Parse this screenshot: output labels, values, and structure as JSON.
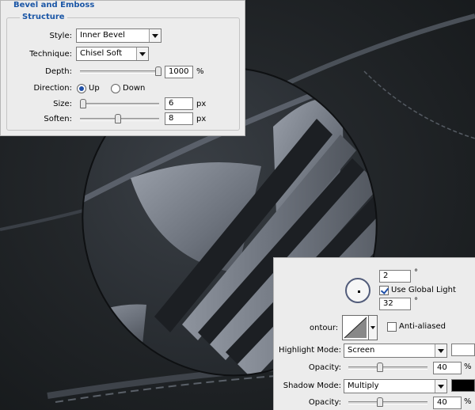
{
  "colors": {
    "accent": "#1a56a6",
    "highlight_swatch": "#ffffff",
    "shadow_swatch": "#000000"
  },
  "bevel_panel": {
    "title": "Bevel and Emboss",
    "section": "Structure",
    "style": {
      "label": "Style:",
      "value": "Inner Bevel"
    },
    "technique": {
      "label": "Technique:",
      "value": "Chisel Soft"
    },
    "depth": {
      "label": "Depth:",
      "value": "1000",
      "unit": "%",
      "slider_fraction": 1.0
    },
    "direction": {
      "label": "Direction:",
      "option_up": "Up",
      "option_down": "Down",
      "selected": "Up"
    },
    "size": {
      "label": "Size:",
      "value": "6",
      "unit": "px",
      "slider_fraction": 0.0
    },
    "soften": {
      "label": "Soften:",
      "value": "8",
      "unit": "px",
      "slider_fraction": 0.5
    }
  },
  "shading_panel": {
    "angle": {
      "value": "2",
      "unit": "°"
    },
    "use_global_light": {
      "label": "Use Global Light",
      "checked": true
    },
    "altitude": {
      "value": "32",
      "unit": "°"
    },
    "gloss_contour": {
      "label": "ontour:",
      "icon": "contour-linear-icon"
    },
    "anti_aliased": {
      "label": "Anti-aliased",
      "checked": false
    },
    "highlight_mode": {
      "label": "Highlight Mode:",
      "value": "Screen"
    },
    "highlight_opacity": {
      "label": "Opacity:",
      "value": "40",
      "unit": "%",
      "slider_fraction": 0.4
    },
    "shadow_mode": {
      "label": "Shadow Mode:",
      "value": "Multiply"
    },
    "shadow_opacity": {
      "label": "Opacity:",
      "value": "40",
      "unit": "%",
      "slider_fraction": 0.4
    }
  }
}
